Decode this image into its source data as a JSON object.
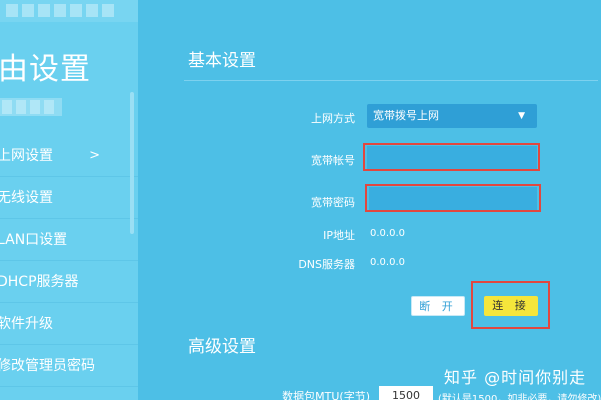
{
  "sidebar": {
    "title": "由设置",
    "items": [
      {
        "label": "上网设置",
        "chevron": ">"
      },
      {
        "label": "无线设置"
      },
      {
        "label": "LAN口设置"
      },
      {
        "label": "DHCP服务器"
      },
      {
        "label": "软件升级"
      },
      {
        "label": "修改管理员密码"
      }
    ]
  },
  "basic": {
    "title": "基本设置",
    "connection_type": {
      "label": "上网方式",
      "value": "宽带拨号上网"
    },
    "account": {
      "label": "宽带帐号",
      "value": ""
    },
    "password": {
      "label": "宽带密码",
      "value": ""
    },
    "ip": {
      "label": "IP地址",
      "value": "0.0.0.0"
    },
    "dns": {
      "label": "DNS服务器",
      "value": "0.0.0.0"
    },
    "disconnect_label": "断 开",
    "connect_label": "连 接"
  },
  "advanced": {
    "title": "高级设置",
    "mtu": {
      "label": "数据包MTU(字节)",
      "value": "1500",
      "hint": "(默认是1500，如非必要，请勿修改)"
    }
  },
  "watermark": "知乎 @时间你别走",
  "colors": {
    "accent": "#2f9fd6",
    "highlight": "#e2473f",
    "connect_button": "#f5e63b"
  }
}
